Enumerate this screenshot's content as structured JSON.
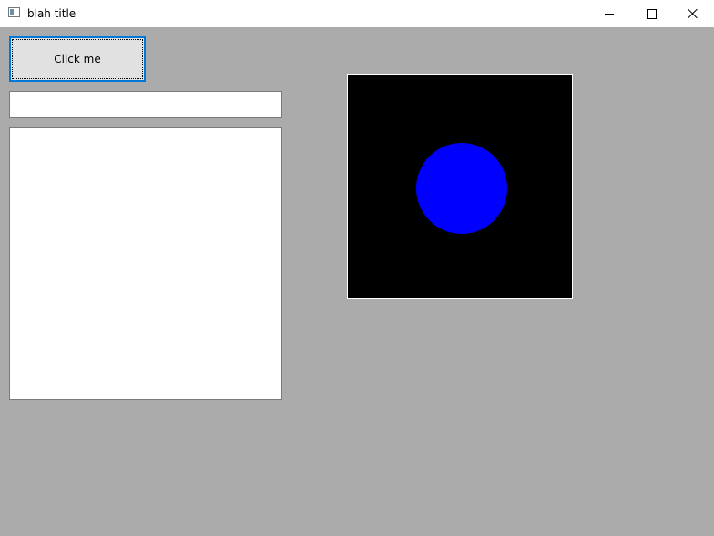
{
  "window": {
    "title": "blah title",
    "icon": "app-window-icon",
    "controls": [
      "minimize-icon",
      "maximize-icon",
      "close-icon"
    ]
  },
  "main": {
    "button_label": "Click me",
    "text_input": {
      "value": "",
      "placeholder": ""
    },
    "text_area": {
      "value": ""
    },
    "canvas": {
      "background_color": "#000000",
      "shape": "circle",
      "shape_color": "#0000ff"
    }
  },
  "colors": {
    "window_background": "#ababab",
    "focus_accent": "#0078d7"
  }
}
